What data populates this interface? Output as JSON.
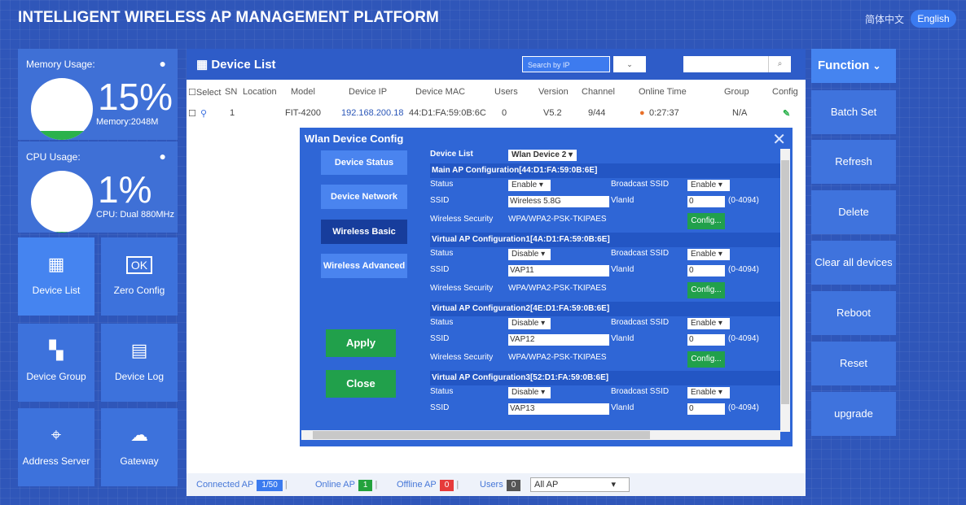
{
  "header": {
    "title": "INTELLIGENT WIRELESS AP MANAGEMENT PLATFORM",
    "lang_cn": "简体中文",
    "lang_en": "English"
  },
  "memory": {
    "label": "Memory Usage:",
    "value": "15%",
    "sub": "Memory:2048M",
    "percent": 15
  },
  "cpu": {
    "label": "CPU Usage:",
    "value": "1%",
    "sub": "CPU: Dual 880MHz",
    "percent": 1
  },
  "nav": {
    "device_list": "Device List",
    "zero_config": "Zero Config",
    "device_group": "Device Group",
    "device_log": "Device Log",
    "address_server": "Address Server",
    "gateway": "Gateway"
  },
  "main": {
    "title": "Device List",
    "search_placeholder": "Search by IP",
    "columns": [
      "Select",
      "SN",
      "Location",
      "Model",
      "Device IP",
      "Device MAC",
      "Users",
      "Version",
      "Channel",
      "Online Time",
      "Group",
      "Config"
    ],
    "row": {
      "sn": "1",
      "model": "FIT-4200",
      "ip": "192.168.200.18",
      "mac": "44:D1:FA:59:0B:6C",
      "users": "0",
      "version": "V5.2",
      "channel": "9/44",
      "online": "0:27:37",
      "group": "N/A"
    }
  },
  "statusbar": {
    "connected_label": "Connected AP",
    "connected_val": "1/50",
    "online_label": "Online AP",
    "online_val": "1",
    "offline_label": "Offline AP",
    "offline_val": "0",
    "users_label": "Users",
    "users_val": "0",
    "filter": "All AP"
  },
  "modal": {
    "title": "Wlan Device Config",
    "tabs": [
      "Device Status",
      "Device Network",
      "Wireless Basic",
      "Wireless Advanced"
    ],
    "apply": "Apply",
    "close": "Close",
    "device_list_label": "Device List",
    "device_list_value": "Wlan Device 2",
    "labels": {
      "status": "Status",
      "broadcast": "Broadcast SSID",
      "ssid": "SSID",
      "vlanid": "VlanId",
      "security": "Wireless Security",
      "range": "(0-4094)",
      "config": "Config..."
    },
    "sections": [
      {
        "title": "Main AP Configuration[44:D1:FA:59:0B:6E]",
        "status": "Enable",
        "broadcast": "Enable",
        "ssid": "Wireless 5.8G",
        "vlan": "0",
        "security": "WPA/WPA2-PSK-TKIPAES"
      },
      {
        "title": "Virtual AP Configuration1[4A:D1:FA:59:0B:6E]",
        "status": "Disable",
        "broadcast": "Enable",
        "ssid": "VAP11",
        "vlan": "0",
        "security": "WPA/WPA2-PSK-TKIPAES"
      },
      {
        "title": "Virtual AP Configuration2[4E:D1:FA:59:0B:6E]",
        "status": "Disable",
        "broadcast": "Enable",
        "ssid": "VAP12",
        "vlan": "0",
        "security": "WPA/WPA2-PSK-TKIPAES"
      },
      {
        "title": "Virtual AP Configuration3[52:D1:FA:59:0B:6E]",
        "status": "Disable",
        "broadcast": "Enable",
        "ssid": "VAP13",
        "vlan": "0"
      }
    ]
  },
  "function": {
    "title": "Function",
    "buttons": [
      "Batch Set",
      "Refresh",
      "Delete",
      "Clear all devices",
      "Reboot",
      "Reset",
      "upgrade"
    ]
  }
}
